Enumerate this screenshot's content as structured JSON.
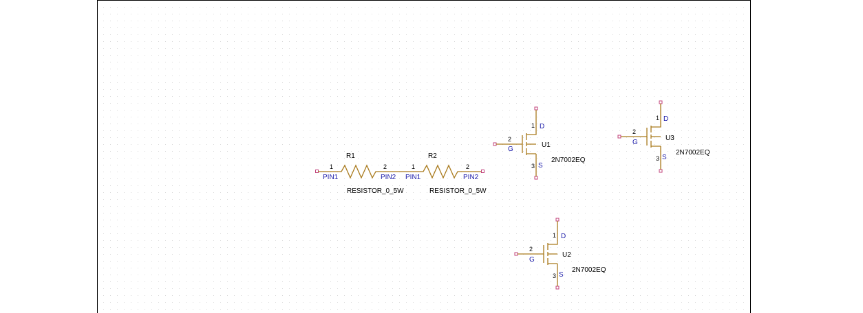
{
  "colors": {
    "component": "#a97a1c",
    "pin_name": "#1a1aa8",
    "terminal": "#c0407a",
    "grid_dot": "#d6d6d6",
    "border": "#000000"
  },
  "resistors": [
    {
      "ref": "R1",
      "value": "RESISTOR_0_5W",
      "pin1_num": "1",
      "pin2_num": "2",
      "pin1_name": "PIN1",
      "pin2_name": "PIN2"
    },
    {
      "ref": "R2",
      "value": "RESISTOR_0_5W",
      "pin1_num": "1",
      "pin2_num": "2",
      "pin1_name": "PIN1",
      "pin2_name": "PIN2"
    }
  ],
  "mosfets": [
    {
      "ref": "U1",
      "value": "2N7002EQ",
      "d_num": "1",
      "g_num": "2",
      "s_num": "3",
      "d_name": "D",
      "g_name": "G",
      "s_name": "S"
    },
    {
      "ref": "U3",
      "value": "2N7002EQ",
      "d_num": "1",
      "g_num": "2",
      "s_num": "3",
      "d_name": "D",
      "g_name": "G",
      "s_name": "S"
    },
    {
      "ref": "U2",
      "value": "2N7002EQ",
      "d_num": "1",
      "g_num": "2",
      "s_num": "3",
      "d_name": "D",
      "g_name": "G",
      "s_name": "S"
    }
  ]
}
